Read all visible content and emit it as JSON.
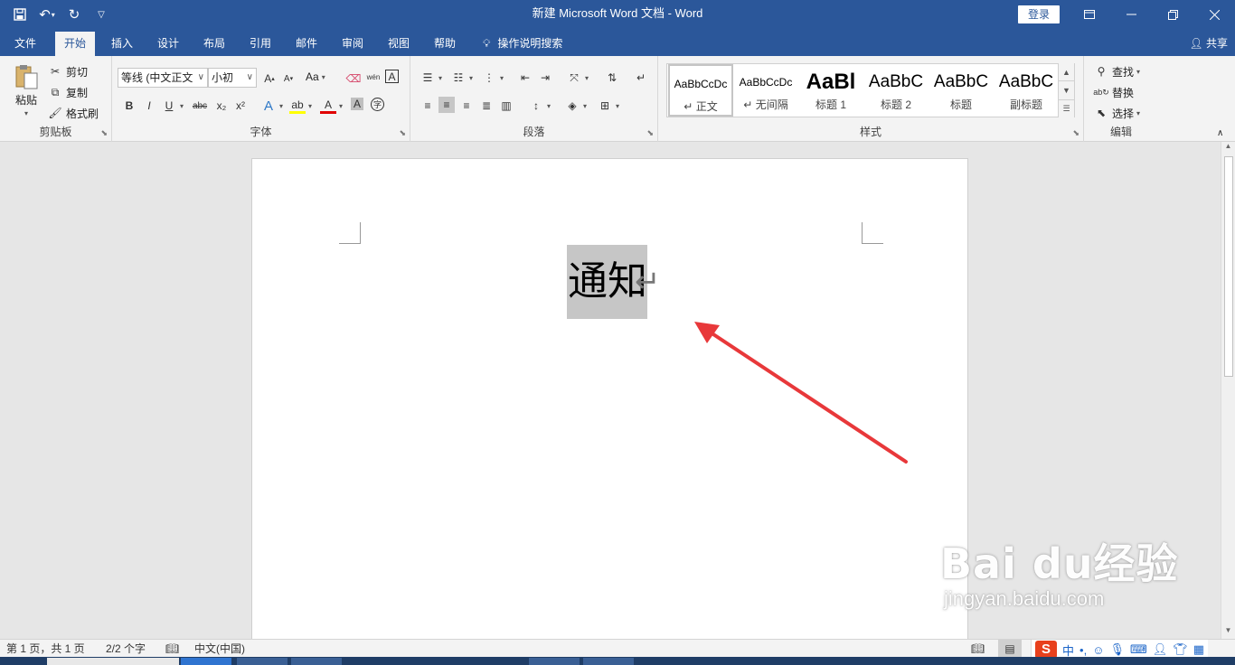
{
  "window": {
    "title": "新建 Microsoft Word 文档  -  Word",
    "login_label": "登录"
  },
  "icons": {
    "save": "save-icon",
    "undo": "undo-icon",
    "redo": "redo-icon",
    "customize": "customize-qat-icon"
  },
  "menu": {
    "tabs": [
      "文件",
      "开始",
      "插入",
      "设计",
      "布局",
      "引用",
      "邮件",
      "审阅",
      "视图",
      "帮助"
    ],
    "active_index": 1,
    "tell_me": "操作说明搜索",
    "share": "共享"
  },
  "ribbon": {
    "clipboard": {
      "label": "剪贴板",
      "paste": "粘贴",
      "cut": "剪切",
      "copy": "复制",
      "format_painter": "格式刷"
    },
    "font": {
      "label": "字体",
      "font_name": "等线 (中文正文",
      "font_size": "小初",
      "change_case": "Aa",
      "bold": "B",
      "italic": "I",
      "underline": "U",
      "strikethrough": "abc",
      "subscript": "x₂",
      "superscript": "x²",
      "phonetic": "wén"
    },
    "paragraph": {
      "label": "段落"
    },
    "styles": {
      "label": "样式",
      "items": [
        {
          "preview": "AaBbCcDc",
          "name": "正文"
        },
        {
          "preview": "AaBbCcDc",
          "name": "无间隔"
        },
        {
          "preview": "AaBl",
          "name": "标题 1"
        },
        {
          "preview": "AaBbC",
          "name": "标题 2"
        },
        {
          "preview": "AaBbC",
          "name": "标题"
        },
        {
          "preview": "AaBbC",
          "name": "副标题"
        }
      ]
    },
    "editing": {
      "label": "编辑",
      "find": "查找",
      "replace": "替换",
      "select": "选择"
    }
  },
  "document": {
    "heading_text": "通知",
    "paragraph_mark": "↵"
  },
  "watermark": {
    "brand": "Bai du经验",
    "url": "jingyan.baidu.com"
  },
  "status": {
    "page": "第 1 页，共 1 页",
    "words": "2/2 个字",
    "language": "中文(中国)"
  },
  "ime": {
    "logo": "S",
    "mode": "中",
    "punct": "•,"
  },
  "colors": {
    "accent": "#2b579a",
    "selection": "#c6c6c6",
    "arrow": "#e8383a"
  }
}
